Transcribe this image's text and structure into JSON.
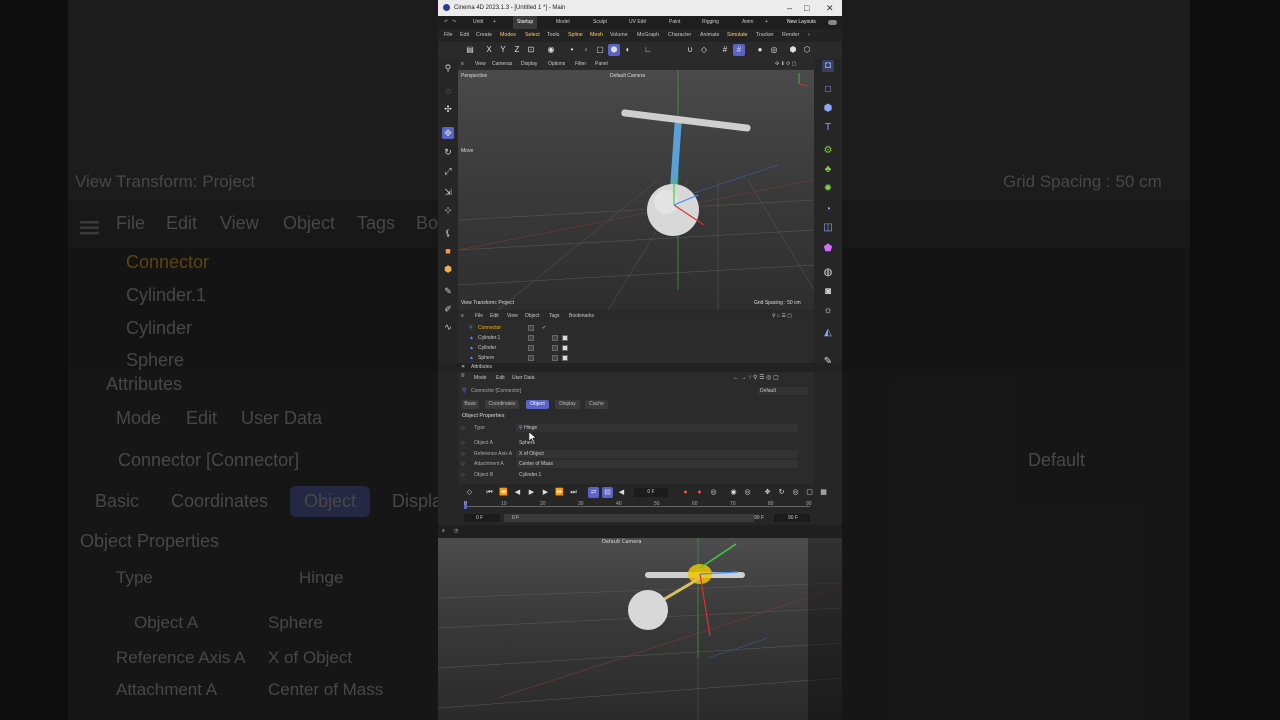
{
  "background": {
    "view_transform": "View Transform: Project",
    "grid_spacing": "Grid Spacing : 50 cm",
    "menu": [
      "File",
      "Edit",
      "View",
      "Object",
      "Tags",
      "Bo"
    ],
    "objects": [
      "Connector",
      "Cylinder.1",
      "Cylinder",
      "Sphere"
    ],
    "attributes_title": "Attributes",
    "attr_menu": [
      "Mode",
      "Edit",
      "User Data"
    ],
    "connector_label": "Connector [Connector]",
    "tabs": [
      "Basic",
      "Coordinates",
      "Object",
      "Displa"
    ],
    "object_properties": "Object Properties",
    "type_label": "Type",
    "type_value": "Hinge",
    "object_a_label": "Object A",
    "object_a_value": "Sphere",
    "ref_axis_label": "Reference Axis A",
    "ref_axis_value": "X of Object",
    "attach_label": "Attachment A",
    "attach_value": "Center of Mass",
    "default_label": "Default"
  },
  "window": {
    "title": "Cinema 4D 2023.1.3 - [Untitled 1 *] - Main",
    "layout_tabs": [
      "Untit",
      "Startup",
      "Model",
      "Sculpt",
      "UV Edit",
      "Paint",
      "Rigging",
      "Anim"
    ],
    "new_layouts": "New Layouts",
    "menu": [
      "File",
      "Edit",
      "Create",
      "Modes",
      "Select",
      "Tools",
      "Spline",
      "Mesh",
      "Volume",
      "MoGraph",
      "Character",
      "Animate",
      "Simulate",
      "Tracker",
      "Render"
    ],
    "viewport_menu": [
      "View",
      "Cameras",
      "Display",
      "Options",
      "Filter",
      "Panel"
    ],
    "viewport_name": "Perspective",
    "camera_name": "Default Camera",
    "move_label": "Move",
    "view_transform": "View Transform: Project",
    "grid_spacing": "Grid Spacing : 50 cm",
    "om_menu": [
      "File",
      "Edit",
      "View",
      "Object",
      "Tags",
      "Bookmarks"
    ],
    "objects": [
      "Connector",
      "Cylinder.1",
      "Cylinder",
      "Sphere"
    ],
    "attributes_title": "Attributes",
    "attr_menu": [
      "Mode",
      "Edit",
      "User Data"
    ],
    "connector_label": "Connector [Connector]",
    "default_label": "Default",
    "tabs": [
      "Basic",
      "Coordinates",
      "Object",
      "Display",
      "Cache"
    ],
    "object_properties": "Object Properties",
    "props": [
      {
        "label": "Type",
        "value": "Hinge"
      },
      {
        "label": "Object A",
        "value": "Sphere"
      },
      {
        "label": "Reference Axis A",
        "value": "X of Object"
      },
      {
        "label": "Attachment A",
        "value": "Center of Mass"
      },
      {
        "label": "Object B",
        "value": "Cylinder.1"
      }
    ],
    "frame": "0 F",
    "ticks": [
      "0",
      "10",
      "20",
      "30",
      "40",
      "50",
      "60",
      "70",
      "80",
      "90"
    ],
    "range_start": "0 F",
    "range_start2": "0 F",
    "range_end": "90 F",
    "range_end2": "90 F"
  },
  "preview": {
    "camera_name": "Default Camera"
  },
  "colors": {
    "accent": "#5a63c8",
    "connector": "#f0b400"
  }
}
